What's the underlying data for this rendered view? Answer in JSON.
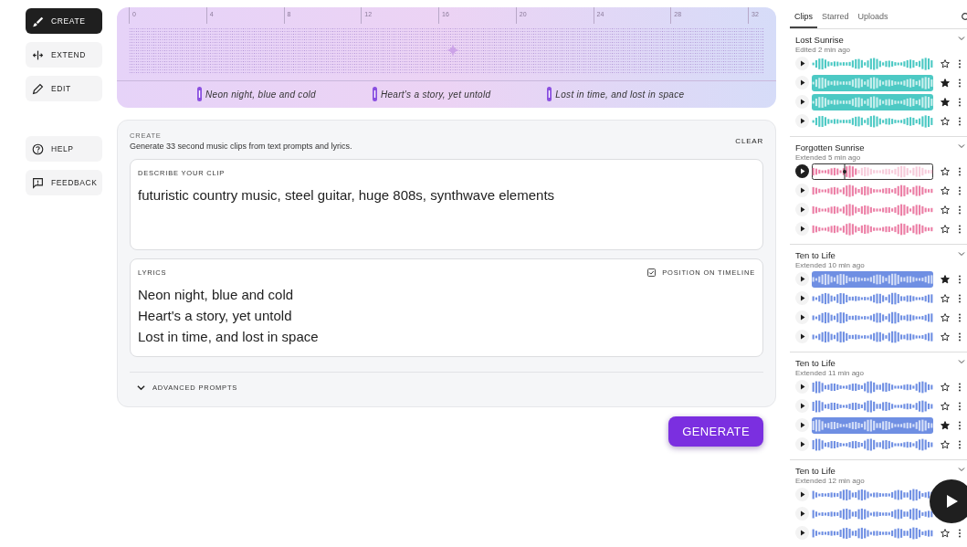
{
  "nav": {
    "items": [
      {
        "label": "CREATE",
        "selected": true
      },
      {
        "label": "EXTEND",
        "selected": false
      },
      {
        "label": "EDIT",
        "selected": false
      }
    ],
    "help_items": [
      {
        "label": "HELP"
      },
      {
        "label": "FEEDBACK"
      }
    ]
  },
  "timeline": {
    "ticks": [
      "0",
      "4",
      "8",
      "12",
      "16",
      "20",
      "24",
      "28",
      "32"
    ],
    "lyric_markers": [
      "Neon night, blue and cold",
      "Heart's a story, yet untold",
      "Lost in time, and lost in space"
    ]
  },
  "create_panel": {
    "title": "CREATE",
    "description": "Generate 33 second music clips from text prompts and lyrics.",
    "clear_button": "CLEAR",
    "describe": {
      "label": "DESCRIBE YOUR CLIP",
      "value": "futuristic country music, steel guitar, huge 808s, synthwave elements"
    },
    "lyrics": {
      "label": "LYRICS",
      "position_on_timeline": {
        "label": "POSITION ON TIMELINE",
        "checked": true
      },
      "lines": [
        "Neon night, blue and cold",
        "Heart's a story, yet untold",
        "Lost in time, and lost in space"
      ]
    },
    "advanced": {
      "label": "ADVANCED PROMPTS",
      "expanded": false
    },
    "generate_button": "GENERATE"
  },
  "library": {
    "tabs": [
      {
        "label": "Clips",
        "selected": true
      },
      {
        "label": "Starred",
        "selected": false
      },
      {
        "label": "Uploads",
        "selected": false
      }
    ],
    "groups": [
      {
        "title": "Lost Sunrise",
        "subtitle": "Edited 2 min ago",
        "color": "#4cc9c4",
        "expanded": true,
        "clips": [
          {
            "selected": false,
            "playing": false,
            "starred": false
          },
          {
            "selected": true,
            "playing": false,
            "starred": true
          },
          {
            "selected": true,
            "playing": false,
            "starred": true
          },
          {
            "selected": false,
            "playing": false,
            "starred": false
          }
        ]
      },
      {
        "title": "Forgotten Sunrise",
        "subtitle": "Extended 5 min ago",
        "color": "#ec7fa6",
        "expanded": true,
        "clips": [
          {
            "selected": false,
            "playing": true,
            "starred": false
          },
          {
            "selected": false,
            "playing": false,
            "starred": false
          },
          {
            "selected": false,
            "playing": false,
            "starred": false
          },
          {
            "selected": false,
            "playing": false,
            "starred": false
          }
        ]
      },
      {
        "title": "Ten to Life",
        "subtitle": "Extended 10 min ago",
        "color": "#6f8fe3",
        "expanded": true,
        "clips": [
          {
            "selected": true,
            "playing": false,
            "starred": true
          },
          {
            "selected": false,
            "playing": false,
            "starred": false
          },
          {
            "selected": false,
            "playing": false,
            "starred": false
          },
          {
            "selected": false,
            "playing": false,
            "starred": false
          }
        ]
      },
      {
        "title": "Ten to Life",
        "subtitle": "Extended 11 min ago",
        "color": "#6f8fe3",
        "expanded": true,
        "clips": [
          {
            "selected": false,
            "playing": false,
            "starred": false
          },
          {
            "selected": false,
            "playing": false,
            "starred": false
          },
          {
            "selected": true,
            "playing": false,
            "starred": true
          },
          {
            "selected": false,
            "playing": false,
            "starred": false
          }
        ]
      },
      {
        "title": "Ten to Life",
        "subtitle": "Extended 12 min ago",
        "color": "#6f8fe3",
        "expanded": true,
        "clips": [
          {
            "selected": false,
            "playing": false
          },
          {
            "selected": false,
            "playing": false
          },
          {
            "selected": false,
            "playing": false,
            "starred": false
          }
        ]
      }
    ]
  }
}
